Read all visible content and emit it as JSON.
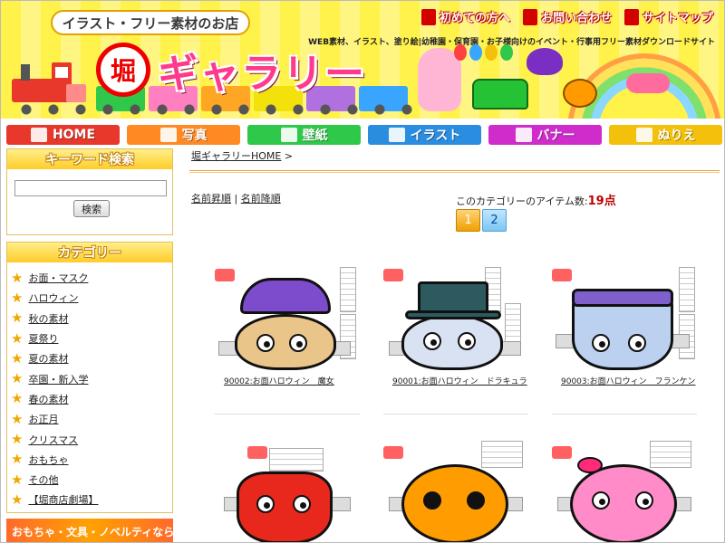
{
  "header": {
    "shop_badge": "イラスト・フリー素材のお店",
    "tagline": "WEB素材、イラスト、塗り絵|幼稚園・保育園・お子様向けのイベント・行事用フリー素材ダウンロードサイト",
    "logo_stamp": "堀",
    "logo_word": "ギャラリー",
    "top_links": [
      "初めての方へ",
      "お問い合わせ",
      "サイトマップ"
    ]
  },
  "nav": [
    {
      "label": "HOME",
      "color": "#e8372b",
      "icon": "house-icon"
    },
    {
      "label": "写真",
      "color": "#ff8a24",
      "icon": "camera-icon"
    },
    {
      "label": "壁紙",
      "color": "#2fc84a",
      "icon": "monitor-icon"
    },
    {
      "label": "イラスト",
      "color": "#2b8de0",
      "icon": "pencil-icon"
    },
    {
      "label": "バナー",
      "color": "#d02ccc",
      "icon": "banner-icon"
    },
    {
      "label": "ぬりえ",
      "color": "#f3c10c",
      "icon": "crayon-icon"
    }
  ],
  "sidebar": {
    "search_title": "キーワード検索",
    "search_value": "",
    "search_button": "検索",
    "category_title": "カテゴリー",
    "categories": [
      "お面・マスク",
      "ハロウィン",
      "秋の素材",
      "夏祭り",
      "夏の素材",
      "卒園・新入学",
      "春の素材",
      "お正月",
      "クリスマス",
      "おもちゃ",
      "その他",
      "【堀商店劇場】"
    ],
    "bottom_banner": "おもちゃ・文具・ノベルティなら"
  },
  "main": {
    "breadcrumb": "堀ギャラリーHOME",
    "breadcrumb_sep": ">",
    "sort_asc": "名前昇順",
    "sort_sep": "|",
    "sort_desc": "名前降順",
    "count_label": "このカテゴリーのアイテム数:",
    "count_value": "19点",
    "pages": [
      "1",
      "2"
    ],
    "current_page": "1",
    "items": [
      {
        "caption": "90002:お面ハロウィン　魔女"
      },
      {
        "caption": "90001:お面ハロウィン　ドラキュラ"
      },
      {
        "caption": "90003:お面ハロウィン　フランケン"
      },
      {
        "caption": ""
      },
      {
        "caption": ""
      },
      {
        "caption": ""
      }
    ]
  },
  "colors": {
    "header_bg": "#fff24a",
    "accent_red": "#c00000",
    "logo_pink": "#ff3a8c"
  }
}
